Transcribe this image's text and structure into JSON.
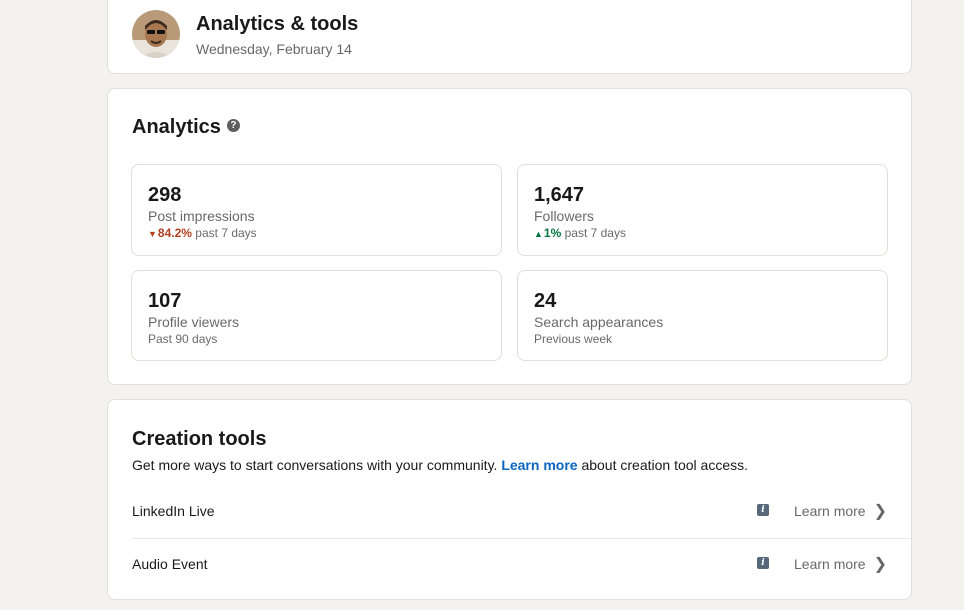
{
  "header": {
    "title": "Analytics & tools",
    "date": "Wednesday, February 14"
  },
  "analytics": {
    "title": "Analytics",
    "help_icon": "help-icon",
    "stats": [
      {
        "value": "298",
        "label": "Post impressions",
        "trend": "84.2%",
        "trend_direction": "down",
        "period": "past 7 days"
      },
      {
        "value": "1,647",
        "label": "Followers",
        "trend": "1%",
        "trend_direction": "up",
        "period": "past 7 days"
      },
      {
        "value": "107",
        "label": "Profile viewers",
        "period": "Past 90 days"
      },
      {
        "value": "24",
        "label": "Search appearances",
        "period": "Previous week"
      }
    ]
  },
  "creation": {
    "title": "Creation tools",
    "desc_before": "Get more ways to start conversations with your community.",
    "desc_link": "Learn more",
    "desc_after": "about creation tool access.",
    "tools": [
      {
        "name": "LinkedIn Live",
        "action": "Learn more"
      },
      {
        "name": "Audio Event",
        "action": "Learn more"
      }
    ]
  },
  "colors": {
    "trend_down": "#b24020",
    "trend_up": "#057642",
    "link": "#0a66c2",
    "background": "#f3f2ef"
  }
}
